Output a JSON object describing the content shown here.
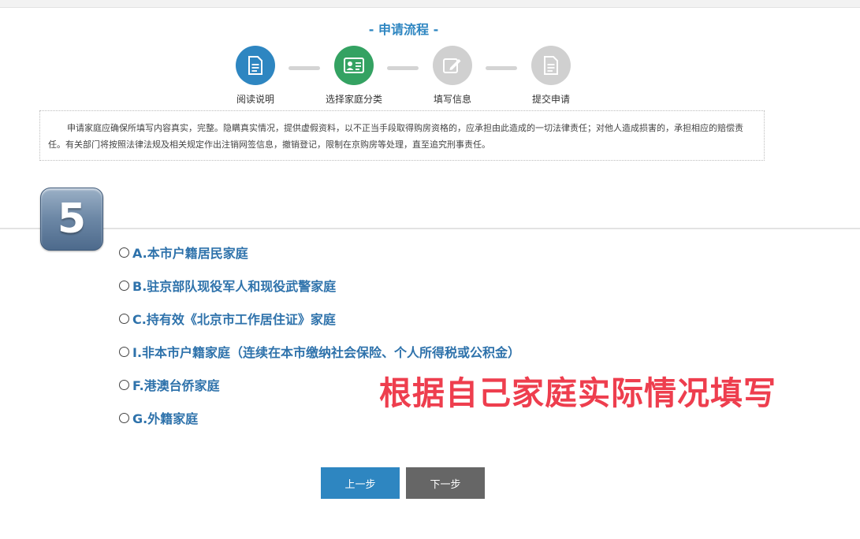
{
  "header": {
    "title": "- 申请流程 -"
  },
  "steps": [
    {
      "label": "阅读说明",
      "color": "#2e86c1",
      "icon": "document-icon"
    },
    {
      "label": "选择家庭分类",
      "color": "#34a262",
      "icon": "id-card-icon"
    },
    {
      "label": "填写信息",
      "color": "#d0d0d0",
      "icon": "edit-icon"
    },
    {
      "label": "提交申请",
      "color": "#d0d0d0",
      "icon": "document-icon"
    }
  ],
  "notice": {
    "text": "申请家庭应确保所填写内容真实，完整。隐瞒真实情况，提供虚假资料，以不正当手段取得购房资格的，应承担由此造成的一切法律责任；对他人造成损害的，承担相应的赔偿责任。有关部门将按照法律法规及相关规定作出注销网签信息，撤销登记，限制在京购房等处理，直至追究刑事责任。"
  },
  "badge": {
    "number": "5"
  },
  "options": [
    {
      "label": "A.本市户籍居民家庭"
    },
    {
      "label": "B.驻京部队现役军人和现役武警家庭"
    },
    {
      "label": "C.持有效《北京市工作居住证》家庭"
    },
    {
      "label": "I.非本市户籍家庭（连续在本市缴纳社会保险、个人所得税或公积金）"
    },
    {
      "label": "F.港澳台侨家庭"
    },
    {
      "label": "G.外籍家庭"
    }
  ],
  "annotation": {
    "text": "根据自己家庭实际情况填写",
    "color": "#ee3e4e"
  },
  "buttons": {
    "prev": {
      "label": "上一步",
      "color": "#2e86c1"
    },
    "next": {
      "label": "下一步",
      "color": "#666666"
    }
  }
}
